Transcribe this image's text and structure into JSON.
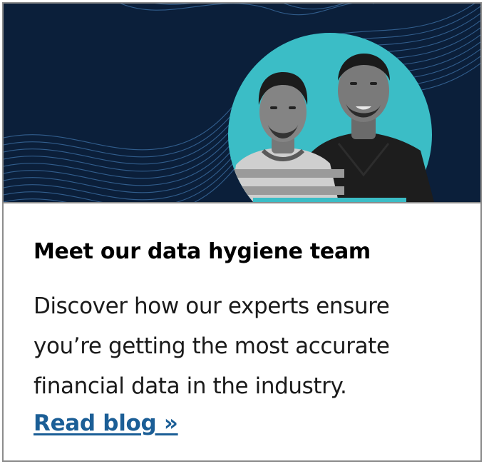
{
  "card": {
    "title": "Meet our data hygiene team",
    "description": "Discover how our experts ensure you’re getting the most accurate financial data in the industry.",
    "link_label": "Read blog »"
  },
  "banner": {
    "image_subject": "two-team-members-photo",
    "background_color": "#0b1f3a",
    "circle_color": "#3bbdc6",
    "wave_color": "#3e72a8"
  },
  "colors": {
    "link": "#1b5e96",
    "border": "#8c8c8c",
    "text": "#1a1a1a"
  }
}
